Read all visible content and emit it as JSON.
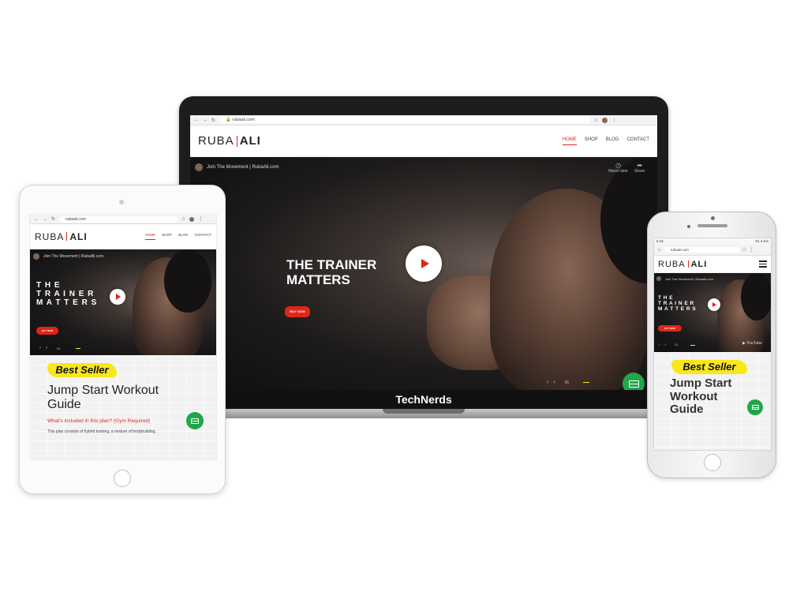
{
  "site": {
    "url": "rubaali.com",
    "logo_left": "RUBA",
    "logo_right": "ALI",
    "nav": [
      "HOME",
      "SHOP",
      "BLOG",
      "CONTACT"
    ],
    "video_title": "Join The Movement | RubaAli.com",
    "watch_later": "Watch later",
    "share": "Share",
    "headline_line1": "THE TRAINER",
    "headline_line2": "MATTERS",
    "headline_spaced_line1": "T H E",
    "headline_spaced_line2": "T R A I N E R",
    "headline_spaced_line3": "M A T T E R S",
    "buy_button": "BUY NOW",
    "slide_index": "01",
    "youtube": "YouTube"
  },
  "promo": {
    "badge": "Best Seller",
    "title_line1": "Jump Start Workout",
    "title_line2": "Guide",
    "phone_title_line1": "Jump Start",
    "phone_title_line2": "Workout",
    "phone_title_line3": "Guide",
    "subtitle": "What's included in this plan? (Gym Required)",
    "description": "This plan consists of hybrid training, a mixture of bodybuilding,"
  },
  "laptop": {
    "brand": "TechNerds"
  },
  "phone_status": {
    "time": "5:44",
    "signal": "51.4 K/s"
  },
  "colors": {
    "accent": "#e1251b",
    "badge": "#f7e71c",
    "mail": "#21a64a"
  }
}
